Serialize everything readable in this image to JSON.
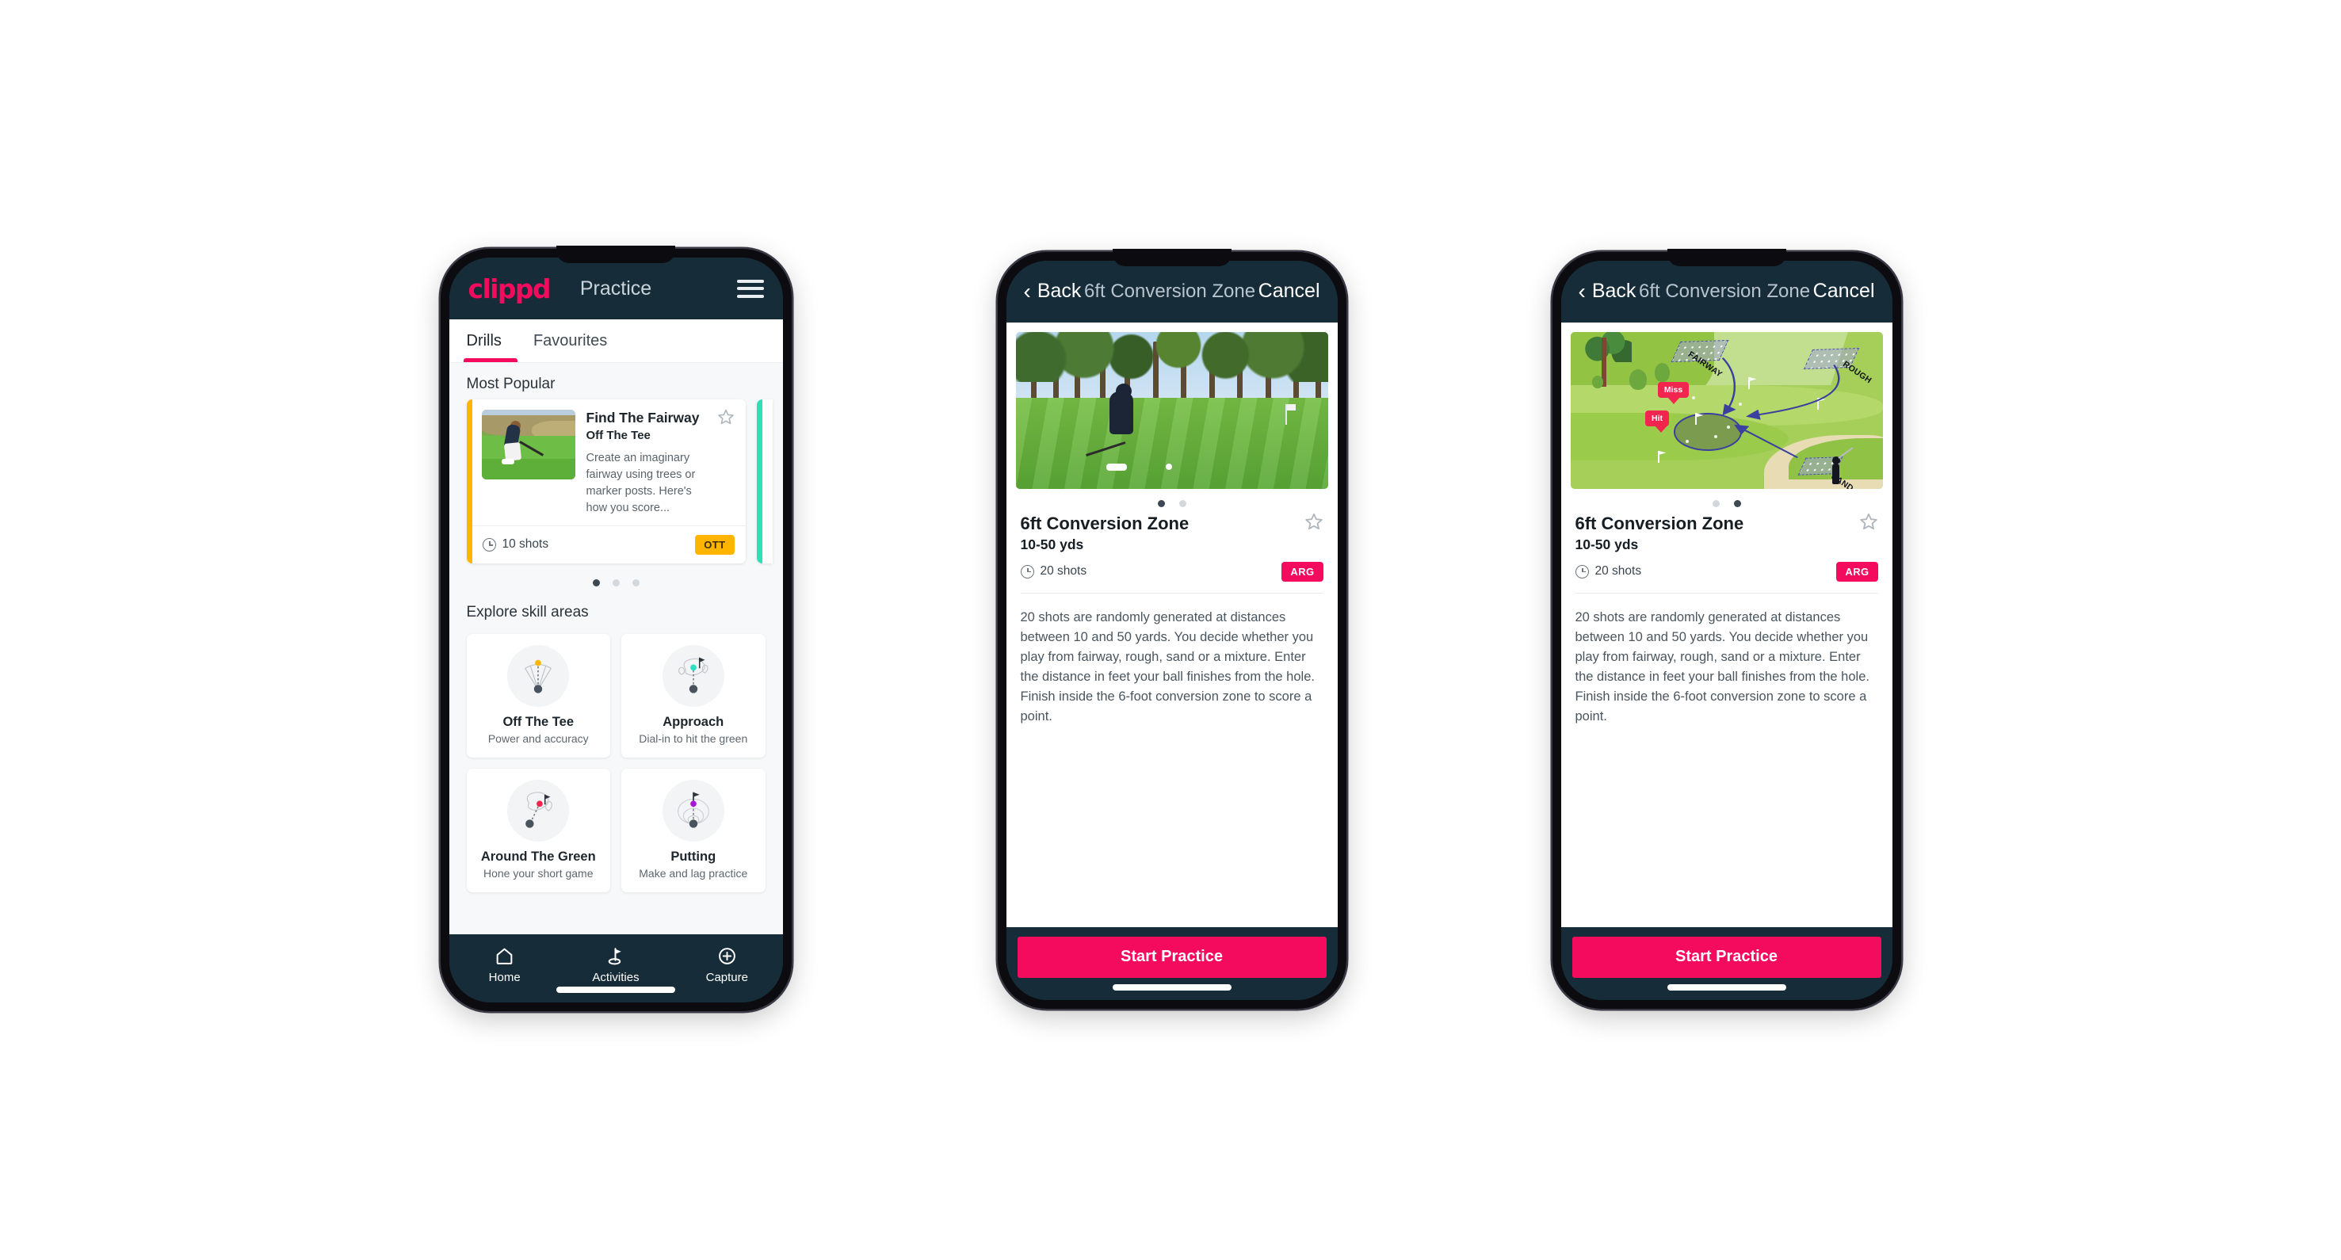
{
  "phone1": {
    "appbar": {
      "brand": "clippd",
      "title": "Practice",
      "menu_icon": "hamburger-menu-icon"
    },
    "tabs": [
      {
        "label": "Drills",
        "active": true
      },
      {
        "label": "Favourites",
        "active": false
      }
    ],
    "most_popular_label": "Most Popular",
    "drill_card": {
      "title": "Find The Fairway",
      "subtitle": "Off The Tee",
      "description": "Create an imaginary fairway using trees or marker posts. Here's how you score...",
      "shots": "10 shots",
      "badge": "OTT",
      "badge_color": "#ffb400",
      "accent_color": "#ffb400",
      "next_card_accent": "#30e0b4",
      "favourite_icon": "star-outline-icon",
      "shots_icon": "clock-icon"
    },
    "carousel_dots": {
      "count": 3,
      "active_index": 0
    },
    "explore_label": "Explore skill areas",
    "skills": [
      {
        "name": "Off The Tee",
        "desc": "Power and accuracy",
        "icon": "tee-fan-icon",
        "accent": "#ffb400"
      },
      {
        "name": "Approach",
        "desc": "Dial-in to hit the green",
        "icon": "approach-green-icon",
        "accent": "#2ee0c0"
      },
      {
        "name": "Around The Green",
        "desc": "Hone your short game",
        "icon": "chip-green-icon",
        "accent": "#f2254f"
      },
      {
        "name": "Putting",
        "desc": "Make and lag practice",
        "icon": "putting-rings-icon",
        "accent": "#a617d6"
      }
    ],
    "bottom_nav": [
      {
        "label": "Home",
        "icon": "home-icon",
        "active": false
      },
      {
        "label": "Activities",
        "icon": "golf-flag-icon",
        "active": true
      },
      {
        "label": "Capture",
        "icon": "plus-circle-icon",
        "active": false
      }
    ]
  },
  "phone2": {
    "navbar": {
      "back": "Back",
      "title": "6ft Conversion Zone",
      "cancel": "Cancel",
      "back_icon": "chevron-left-icon"
    },
    "hero": {
      "type": "photo",
      "alt": "golfer-chipping-photo"
    },
    "carousel_dots": {
      "count": 2,
      "active_index": 0
    },
    "detail": {
      "title": "6ft Conversion Zone",
      "subtitle": "10-50 yds",
      "shots": "20 shots",
      "badge": "ARG",
      "badge_color": "#f50b5d",
      "favourite_icon": "star-outline-icon",
      "shots_icon": "clock-icon",
      "description": "20 shots are randomly generated at distances between 10 and 50 yards. You decide whether you play from fairway, rough, sand or a mixture. Enter the distance in feet your ball finishes from the hole. Finish inside the 6-foot conversion zone to score a point."
    },
    "start_button": "Start Practice"
  },
  "phone3": {
    "navbar": {
      "back": "Back",
      "title": "6ft Conversion Zone",
      "cancel": "Cancel",
      "back_icon": "chevron-left-icon"
    },
    "hero": {
      "type": "diagram",
      "alt": "golf-course-conversion-zone-diagram",
      "zones": [
        "FAIRWAY",
        "ROUGH",
        "SAND"
      ],
      "bubbles": [
        "Miss",
        "Hit"
      ]
    },
    "carousel_dots": {
      "count": 2,
      "active_index": 1
    },
    "detail": {
      "title": "6ft Conversion Zone",
      "subtitle": "10-50 yds",
      "shots": "20 shots",
      "badge": "ARG",
      "badge_color": "#f50b5d",
      "favourite_icon": "star-outline-icon",
      "shots_icon": "clock-icon",
      "description": "20 shots are randomly generated at distances between 10 and 50 yards. You decide whether you play from fairway, rough, sand or a mixture. Enter the distance in feet your ball finishes from the hole. Finish inside the 6-foot conversion zone to score a point."
    },
    "start_button": "Start Practice"
  }
}
